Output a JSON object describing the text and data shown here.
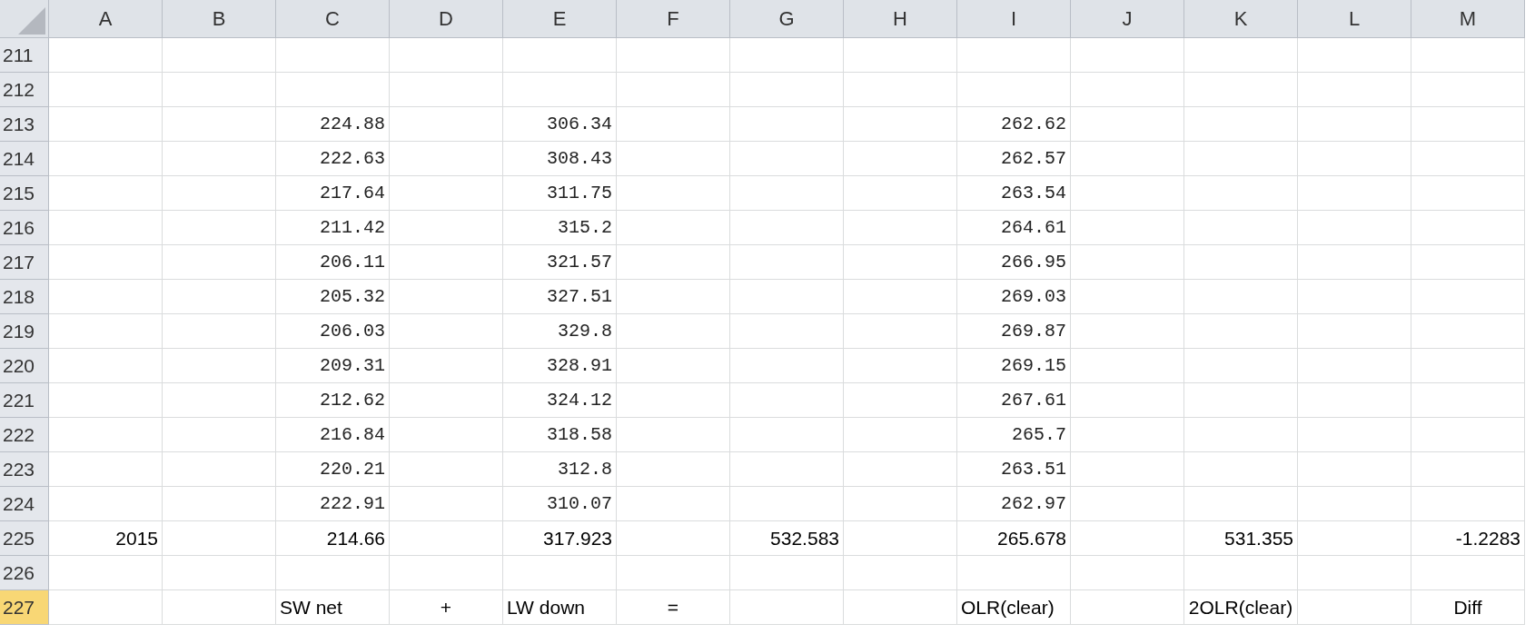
{
  "columns": [
    {
      "label": "A",
      "selected": false
    },
    {
      "label": "B",
      "selected": false
    },
    {
      "label": "C",
      "selected": false
    },
    {
      "label": "D",
      "selected": false
    },
    {
      "label": "E",
      "selected": false
    },
    {
      "label": "F",
      "selected": false
    },
    {
      "label": "G",
      "selected": false
    },
    {
      "label": "H",
      "selected": false
    },
    {
      "label": "I",
      "selected": false
    },
    {
      "label": "J",
      "selected": false
    },
    {
      "label": "K",
      "selected": false
    },
    {
      "label": "L",
      "selected": false
    },
    {
      "label": "M",
      "selected": false
    }
  ],
  "rows": [
    {
      "header": "211",
      "selected": false,
      "cells": []
    },
    {
      "header": "212",
      "selected": false,
      "cells": []
    },
    {
      "header": "213",
      "selected": false,
      "cells": [
        {
          "kind": "empty"
        },
        {
          "kind": "empty"
        },
        {
          "kind": "number",
          "text": "224.88"
        },
        {
          "kind": "empty"
        },
        {
          "kind": "number",
          "text": "306.34"
        },
        {
          "kind": "empty"
        },
        {
          "kind": "empty"
        },
        {
          "kind": "empty"
        },
        {
          "kind": "number",
          "text": "262.62"
        }
      ]
    },
    {
      "header": "214",
      "selected": false,
      "cells": [
        {
          "kind": "empty"
        },
        {
          "kind": "empty"
        },
        {
          "kind": "number",
          "text": "222.63"
        },
        {
          "kind": "empty"
        },
        {
          "kind": "number",
          "text": "308.43"
        },
        {
          "kind": "empty"
        },
        {
          "kind": "empty"
        },
        {
          "kind": "empty"
        },
        {
          "kind": "number",
          "text": "262.57"
        }
      ]
    },
    {
      "header": "215",
      "selected": false,
      "cells": [
        {
          "kind": "empty"
        },
        {
          "kind": "empty"
        },
        {
          "kind": "number",
          "text": "217.64"
        },
        {
          "kind": "empty"
        },
        {
          "kind": "number",
          "text": "311.75"
        },
        {
          "kind": "empty"
        },
        {
          "kind": "empty"
        },
        {
          "kind": "empty"
        },
        {
          "kind": "number",
          "text": "263.54"
        }
      ]
    },
    {
      "header": "216",
      "selected": false,
      "cells": [
        {
          "kind": "empty"
        },
        {
          "kind": "empty"
        },
        {
          "kind": "number",
          "text": "211.42"
        },
        {
          "kind": "empty"
        },
        {
          "kind": "number",
          "text": "315.2"
        },
        {
          "kind": "empty"
        },
        {
          "kind": "empty"
        },
        {
          "kind": "empty"
        },
        {
          "kind": "number",
          "text": "264.61"
        }
      ]
    },
    {
      "header": "217",
      "selected": false,
      "cells": [
        {
          "kind": "empty"
        },
        {
          "kind": "empty"
        },
        {
          "kind": "number",
          "text": "206.11"
        },
        {
          "kind": "empty"
        },
        {
          "kind": "number",
          "text": "321.57"
        },
        {
          "kind": "empty"
        },
        {
          "kind": "empty"
        },
        {
          "kind": "empty"
        },
        {
          "kind": "number",
          "text": "266.95"
        }
      ]
    },
    {
      "header": "218",
      "selected": false,
      "cells": [
        {
          "kind": "empty"
        },
        {
          "kind": "empty"
        },
        {
          "kind": "number",
          "text": "205.32"
        },
        {
          "kind": "empty"
        },
        {
          "kind": "number",
          "text": "327.51"
        },
        {
          "kind": "empty"
        },
        {
          "kind": "empty"
        },
        {
          "kind": "empty"
        },
        {
          "kind": "number",
          "text": "269.03"
        }
      ]
    },
    {
      "header": "219",
      "selected": false,
      "cells": [
        {
          "kind": "empty"
        },
        {
          "kind": "empty"
        },
        {
          "kind": "number",
          "text": "206.03"
        },
        {
          "kind": "empty"
        },
        {
          "kind": "number",
          "text": "329.8"
        },
        {
          "kind": "empty"
        },
        {
          "kind": "empty"
        },
        {
          "kind": "empty"
        },
        {
          "kind": "number",
          "text": "269.87"
        }
      ]
    },
    {
      "header": "220",
      "selected": false,
      "cells": [
        {
          "kind": "empty"
        },
        {
          "kind": "empty"
        },
        {
          "kind": "number",
          "text": "209.31"
        },
        {
          "kind": "empty"
        },
        {
          "kind": "number",
          "text": "328.91"
        },
        {
          "kind": "empty"
        },
        {
          "kind": "empty"
        },
        {
          "kind": "empty"
        },
        {
          "kind": "number",
          "text": "269.15"
        }
      ]
    },
    {
      "header": "221",
      "selected": false,
      "cells": [
        {
          "kind": "empty"
        },
        {
          "kind": "empty"
        },
        {
          "kind": "number",
          "text": "212.62"
        },
        {
          "kind": "empty"
        },
        {
          "kind": "number",
          "text": "324.12"
        },
        {
          "kind": "empty"
        },
        {
          "kind": "empty"
        },
        {
          "kind": "empty"
        },
        {
          "kind": "number",
          "text": "267.61"
        }
      ]
    },
    {
      "header": "222",
      "selected": false,
      "cells": [
        {
          "kind": "empty"
        },
        {
          "kind": "empty"
        },
        {
          "kind": "number",
          "text": "216.84"
        },
        {
          "kind": "empty"
        },
        {
          "kind": "number",
          "text": "318.58"
        },
        {
          "kind": "empty"
        },
        {
          "kind": "empty"
        },
        {
          "kind": "empty"
        },
        {
          "kind": "number",
          "text": "265.7"
        }
      ]
    },
    {
      "header": "223",
      "selected": false,
      "cells": [
        {
          "kind": "empty"
        },
        {
          "kind": "empty"
        },
        {
          "kind": "number",
          "text": "220.21"
        },
        {
          "kind": "empty"
        },
        {
          "kind": "number",
          "text": "312.8"
        },
        {
          "kind": "empty"
        },
        {
          "kind": "empty"
        },
        {
          "kind": "empty"
        },
        {
          "kind": "number",
          "text": "263.51"
        }
      ]
    },
    {
      "header": "224",
      "selected": false,
      "cells": [
        {
          "kind": "empty"
        },
        {
          "kind": "empty"
        },
        {
          "kind": "number",
          "text": "222.91"
        },
        {
          "kind": "empty"
        },
        {
          "kind": "number",
          "text": "310.07"
        },
        {
          "kind": "empty"
        },
        {
          "kind": "empty"
        },
        {
          "kind": "empty"
        },
        {
          "kind": "number",
          "text": "262.97"
        }
      ]
    },
    {
      "header": "225",
      "selected": false,
      "cells": [
        {
          "kind": "value",
          "text": "2015"
        },
        {
          "kind": "empty"
        },
        {
          "kind": "value",
          "text": "214.66"
        },
        {
          "kind": "empty"
        },
        {
          "kind": "value",
          "text": "317.923"
        },
        {
          "kind": "empty"
        },
        {
          "kind": "value",
          "text": "532.583"
        },
        {
          "kind": "empty"
        },
        {
          "kind": "value",
          "text": "265.678"
        },
        {
          "kind": "empty"
        },
        {
          "kind": "value",
          "text": "531.355"
        },
        {
          "kind": "empty"
        },
        {
          "kind": "value",
          "text": "-1.2283"
        }
      ]
    },
    {
      "header": "226",
      "selected": false,
      "cells": []
    },
    {
      "header": "227",
      "selected": true,
      "cells": [
        {
          "kind": "empty"
        },
        {
          "kind": "empty"
        },
        {
          "kind": "label",
          "text": "SW net"
        },
        {
          "kind": "symbol",
          "text": "+"
        },
        {
          "kind": "label",
          "text": "LW down"
        },
        {
          "kind": "symbol",
          "text": "="
        },
        {
          "kind": "empty"
        },
        {
          "kind": "empty"
        },
        {
          "kind": "label",
          "text": "OLR(clear)"
        },
        {
          "kind": "empty"
        },
        {
          "kind": "symbol",
          "text": "2OLR(clear)"
        },
        {
          "kind": "empty"
        },
        {
          "kind": "symbol",
          "text": "Diff"
        }
      ]
    }
  ]
}
